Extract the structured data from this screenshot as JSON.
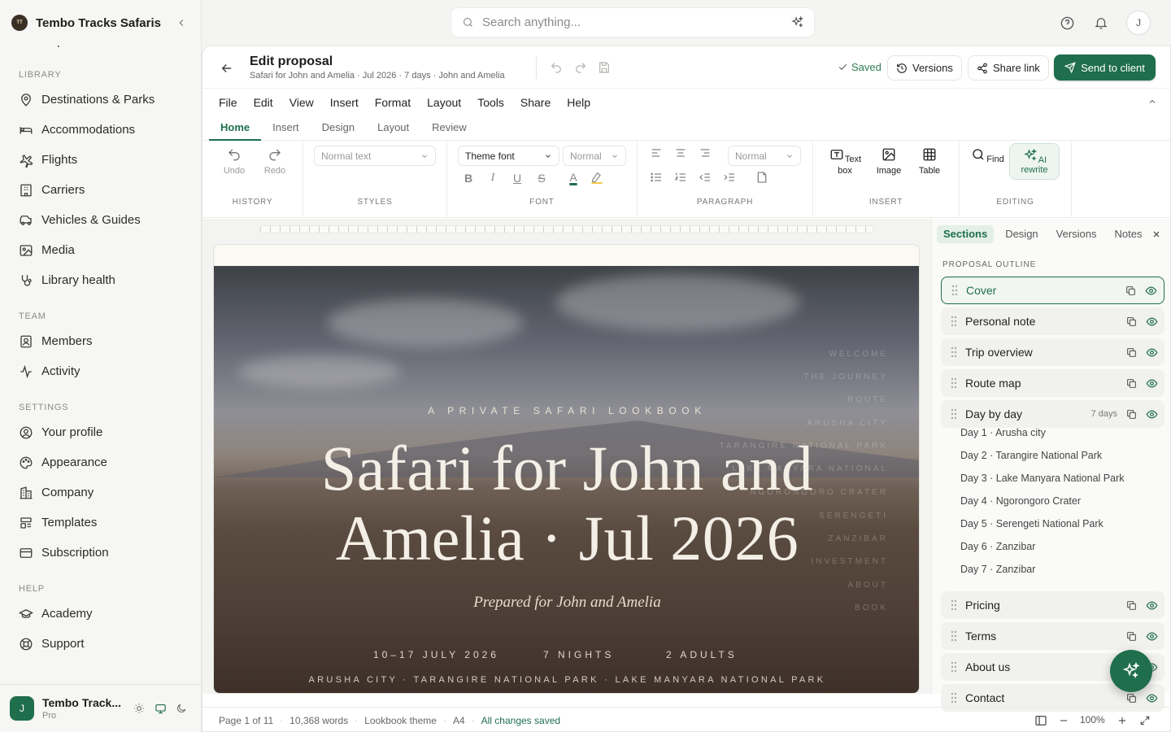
{
  "brand": {
    "name": "Tembo Tracks Safaris",
    "logo_text": "TEMBO"
  },
  "sidebar": {
    "cut_item": "Reports",
    "sections": [
      {
        "title": "LIBRARY",
        "items": [
          {
            "label": "Destinations & Parks",
            "icon": "map-pin-icon"
          },
          {
            "label": "Accommodations",
            "icon": "bed-icon"
          },
          {
            "label": "Flights",
            "icon": "plane-icon"
          },
          {
            "label": "Carriers",
            "icon": "building-icon"
          },
          {
            "label": "Vehicles & Guides",
            "icon": "car-icon"
          },
          {
            "label": "Media",
            "icon": "image-icon"
          },
          {
            "label": "Library health",
            "icon": "stethoscope-icon"
          }
        ]
      },
      {
        "title": "TEAM",
        "items": [
          {
            "label": "Members",
            "icon": "members-icon"
          },
          {
            "label": "Activity",
            "icon": "activity-icon"
          }
        ]
      },
      {
        "title": "SETTINGS",
        "items": [
          {
            "label": "Your profile",
            "icon": "user-circle-icon"
          },
          {
            "label": "Appearance",
            "icon": "palette-icon"
          },
          {
            "label": "Company",
            "icon": "company-icon"
          },
          {
            "label": "Templates",
            "icon": "templates-icon"
          },
          {
            "label": "Subscription",
            "icon": "card-icon"
          }
        ]
      },
      {
        "title": "HELP",
        "items": [
          {
            "label": "Academy",
            "icon": "graduation-cap-icon"
          },
          {
            "label": "Support",
            "icon": "lifebuoy-icon"
          }
        ]
      }
    ],
    "user": {
      "initial": "J",
      "name": "Tembo Track...",
      "plan": "Pro"
    }
  },
  "topbar": {
    "search_placeholder": "Search anything...",
    "avatar": "J"
  },
  "doc": {
    "title": "Edit proposal",
    "subtitle": "Safari for John and Amelia · Jul 2026 · 7 days · John and Amelia",
    "saved": "Saved",
    "versions": "Versions",
    "share": "Share link",
    "send": "Send to client"
  },
  "menu": [
    "File",
    "Edit",
    "View",
    "Insert",
    "Format",
    "Layout",
    "Tools",
    "Share",
    "Help"
  ],
  "tabs": [
    "Home",
    "Insert",
    "Design",
    "Layout",
    "Review"
  ],
  "ribbon": {
    "history": {
      "label": "HISTORY",
      "undo": "Undo",
      "redo": "Redo"
    },
    "styles": {
      "label": "STYLES",
      "value": "Normal text"
    },
    "font": {
      "label": "FONT",
      "family": "Theme font",
      "size": "Normal"
    },
    "paragraph": {
      "label": "PARAGRAPH",
      "spacing": "Normal"
    },
    "insert": {
      "label": "INSERT",
      "textbox": "Text box",
      "image": "Image",
      "table": "Table"
    },
    "editing": {
      "label": "EDITING",
      "find": "Find",
      "ai": "AI rewrite"
    }
  },
  "cover": {
    "eyebrow": "A PRIVATE SAFARI LOOKBOOK",
    "title_line1": "Safari for John and",
    "title_line2": "Amelia · Jul 2026",
    "prepared": "Prepared for John and Amelia",
    "dates": "10–17 JULY 2026",
    "nights": "7 NIGHTS",
    "adults": "2 ADULTS",
    "route": "ARUSHA CITY · TARANGIRE NATIONAL PARK · LAKE MANYARA NATIONAL PARK",
    "toc": [
      "WELCOME",
      "THE JOURNEY",
      "ROUTE",
      "ARUSHA CITY",
      "TARANGIRE NATIONAL PARK",
      "LAKE MANYARA NATIONAL",
      "NGORONGORO CRATER",
      "SERENGETI",
      "ZANZIBAR",
      "INVESTMENT",
      "ABOUT",
      "BOOK"
    ]
  },
  "panel": {
    "tabs": [
      "Sections",
      "Design",
      "Versions",
      "Notes"
    ],
    "heading": "PROPOSAL OUTLINE",
    "items": [
      {
        "label": "Cover"
      },
      {
        "label": "Personal note"
      },
      {
        "label": "Trip overview"
      },
      {
        "label": "Route map"
      },
      {
        "label": "Day by day",
        "badge": "7 days"
      },
      {
        "label": "Pricing"
      },
      {
        "label": "Terms"
      },
      {
        "label": "About us"
      },
      {
        "label": "Contact"
      }
    ],
    "days": [
      "Day 1 · Arusha city",
      "Day 2 · Tarangire National Park",
      "Day 3 · Lake Manyara National Park",
      "Day 4 · Ngorongoro Crater",
      "Day 5 · Serengeti National Park",
      "Day 6 · Zanzibar",
      "Day 7 · Zanzibar"
    ]
  },
  "status": {
    "page": "Page 1 of 11",
    "words": "10,368 words",
    "theme": "Lookbook theme",
    "size": "A4",
    "saved": "All changes saved",
    "zoom": "100%"
  },
  "colors": {
    "accent": "#1f6e4c"
  }
}
